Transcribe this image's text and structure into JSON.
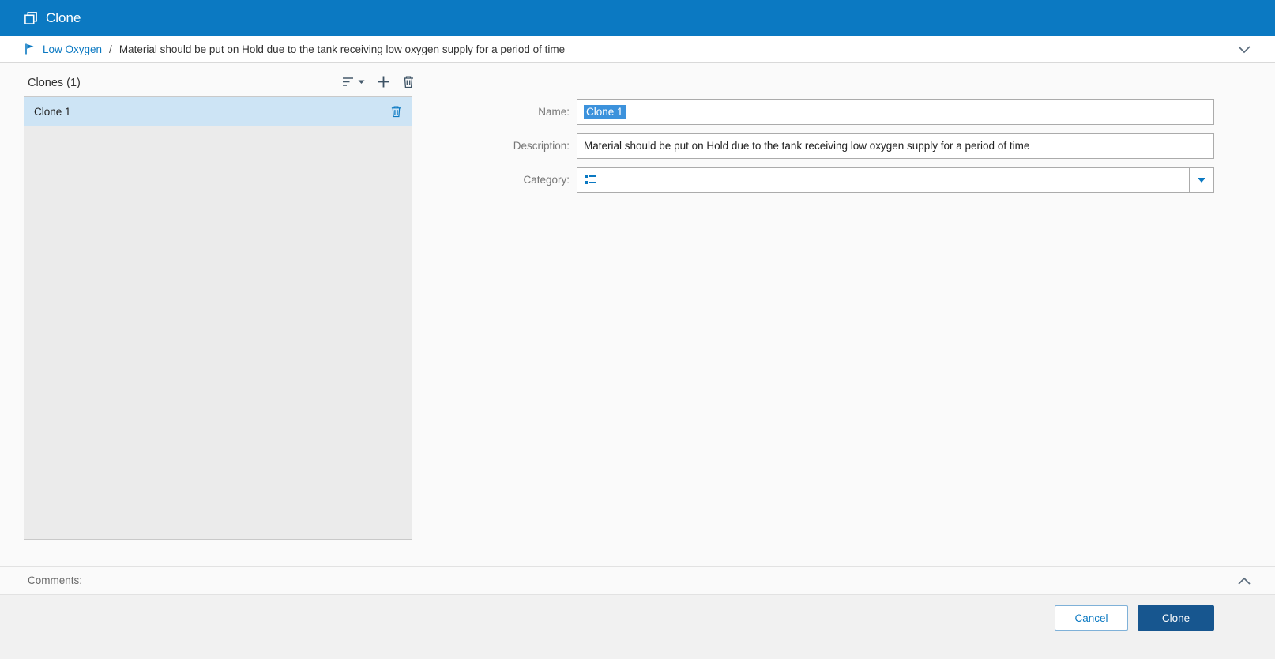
{
  "header": {
    "title": "Clone"
  },
  "breadcrumb": {
    "parent": "Low Oxygen",
    "separator": "/",
    "current": "Material should be put on Hold due to the tank receiving low oxygen supply for a period of time"
  },
  "clones": {
    "title": "Clones (1)",
    "items": [
      {
        "label": "Clone 1",
        "selected": true
      }
    ]
  },
  "form": {
    "name_label": "Name:",
    "name_value": "Clone 1",
    "description_label": "Description:",
    "description_value": "Material should be put on Hold due to the tank receiving low oxygen supply for a period of time",
    "category_label": "Category:",
    "category_value": ""
  },
  "comments": {
    "label": "Comments:"
  },
  "footer": {
    "cancel_label": "Cancel",
    "clone_label": "Clone"
  },
  "icons": {
    "header": "clone-icon",
    "breadcrumb_flag": "flag-icon",
    "breadcrumb_right": "chevron-down-icon",
    "list_tools": [
      "filter-icon",
      "add-icon",
      "delete-icon"
    ],
    "row_action": "delete-icon",
    "category_field": "category-list-icon",
    "category_dropdown": "caret-down-icon",
    "comments_toggle": "chevron-up-icon"
  },
  "colors": {
    "header_bg": "#0b79c2",
    "accent": "#0b79c2",
    "text_selection": "#3c92dc",
    "selected_row_bg": "#cde4f5",
    "primary_button_bg": "#17568f"
  }
}
